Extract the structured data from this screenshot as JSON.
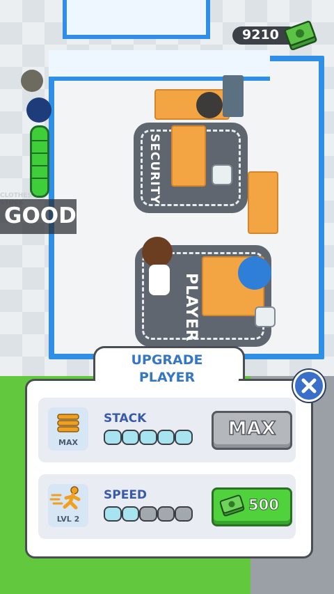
{
  "hud": {
    "money": "9210",
    "money_icon": "cash-stack-icon",
    "status_label": "GOOD",
    "floor_tag": "CLOTHES STOCK"
  },
  "zones": {
    "security_label": "SECURITY",
    "player_label": "PLAYER"
  },
  "upgrade_panel": {
    "title_line1": "UPGRADE",
    "title_line2": "PLAYER",
    "close_icon": "close-icon",
    "rows": [
      {
        "name": "STACK",
        "icon": "stack-icon",
        "level_label": "MAX",
        "progress": {
          "filled": 5,
          "total": 5
        },
        "button": {
          "type": "max",
          "label": "MAX"
        }
      },
      {
        "name": "SPEED",
        "icon": "running-man-icon",
        "level_label": "LVL 2",
        "progress": {
          "filled": 2,
          "total": 5
        },
        "button": {
          "type": "buy",
          "label": "500",
          "icon": "cash-icon"
        }
      }
    ]
  },
  "colors": {
    "accent_blue": "#3576c5",
    "buy_green": "#4fd23c",
    "max_gray": "#b4b7bb",
    "wall_blue": "#2f8ee6",
    "progress_on": "#a8e4f0"
  }
}
